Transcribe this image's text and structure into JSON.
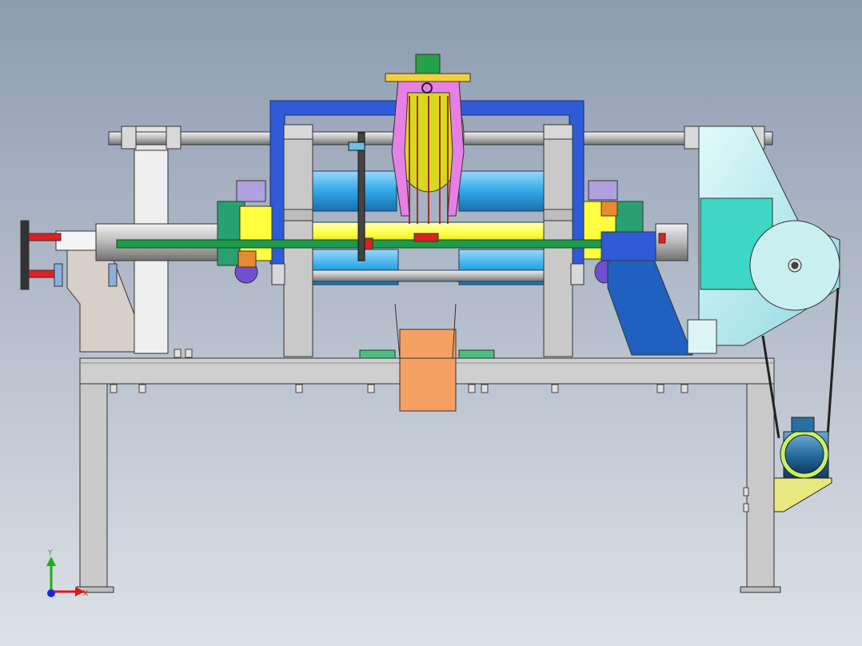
{
  "scene": {
    "background_top": "#8e9cb0",
    "background_bottom": "#dde1e8"
  },
  "triad": {
    "y_label": "Y",
    "x_label": "X",
    "y_color": "#19b019",
    "x_color": "#e01818",
    "z_color": "#1a2ad8"
  },
  "colors": {
    "frame_gray": "#c9c9c9",
    "frame_blue": "#2f5bd8",
    "roller_blue": "#2fa8e8",
    "roller_yellow": "#ffff40",
    "shaft_green": "#1f9a4a",
    "cover_cyan": "#3ed6c4",
    "cover_light": "#c8f0f0",
    "bracket_blue": "#2060c0",
    "basket_yellow": "#d8d820",
    "hopper_orange": "#f7a064",
    "frame_pink": "#e680e6",
    "motor_blue": "#2a6fa0",
    "motor_green": "#c8f06a",
    "mount_yellow": "#e8e880",
    "bracket_purple": "#7050d0",
    "bracket_orange": "#e88a30",
    "cradle_white": "#e8e8e8",
    "stand_beige": "#d8d0c8"
  }
}
